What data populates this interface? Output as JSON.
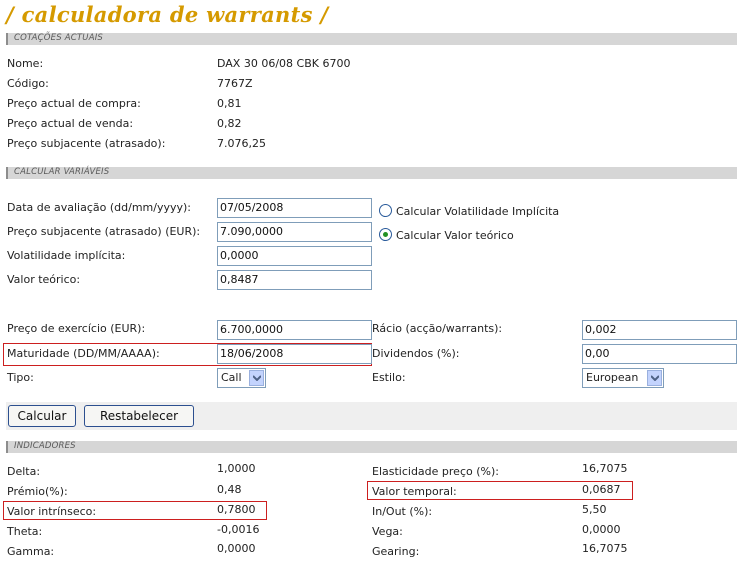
{
  "title": "/ calculadora de warrants /",
  "cotacoes": {
    "header": "COTAÇÕES ACTUAIS",
    "rows": [
      {
        "label": "Nome:",
        "value": "DAX 30 06/08 CBK 6700"
      },
      {
        "label": "Código:",
        "value": "7767Z"
      },
      {
        "label": "Preço actual de compra:",
        "value": "0,81"
      },
      {
        "label": "Preço actual de venda:",
        "value": "0,82"
      },
      {
        "label": "Preço subjacente (atrasado):",
        "value": "7.076,25"
      }
    ]
  },
  "calcular": {
    "header": "CALCULAR VARIÁVEIS",
    "data_avaliacao": {
      "label": "Data de avaliação (dd/mm/yyyy):",
      "value": "07/05/2008"
    },
    "preco_subjacente": {
      "label": "Preço subjacente (atrasado) (EUR):",
      "value": "7.090,0000"
    },
    "volatilidade": {
      "label": "Volatilidade implícita:",
      "value": "0,0000"
    },
    "valor_teorico": {
      "label": "Valor teórico:",
      "value": "0,8487"
    },
    "radio_volatilidade": "Calcular Volatilidade Implícita",
    "radio_valor": "Calcular Valor teórico",
    "preco_exercicio": {
      "label": "Preço de exercício (EUR):",
      "value": "6.700,0000"
    },
    "maturidade": {
      "label": "Maturidade (DD/MM/AAAA):",
      "value": "18/06/2008"
    },
    "tipo": {
      "label": "Tipo:",
      "value": "Call"
    },
    "racio": {
      "label": "Rácio (acção/warrants):",
      "value": "0,002"
    },
    "dividendos": {
      "label": "Dividendos (%):",
      "value": "0,00"
    },
    "estilo": {
      "label": "Estilo:",
      "value": "European"
    }
  },
  "buttons": {
    "calcular": "Calcular",
    "restabelecer": "Restabelecer"
  },
  "indicadores": {
    "header": "INDICADORES",
    "left": [
      {
        "label": "Delta:",
        "value": "1,0000"
      },
      {
        "label": "Prémio(%):",
        "value": "0,48"
      },
      {
        "label": "Valor intrínseco:",
        "value": "0,7800"
      },
      {
        "label": "Theta:",
        "value": "-0,0016"
      },
      {
        "label": "Gamma:",
        "value": "0,0000"
      }
    ],
    "right": [
      {
        "label": "Elasticidade preço (%):",
        "value": "16,7075"
      },
      {
        "label": "Valor temporal:",
        "value": "0,0687"
      },
      {
        "label": "In/Out (%):",
        "value": "5,50"
      },
      {
        "label": "Vega:",
        "value": "0,0000"
      },
      {
        "label": "Gearing:",
        "value": "16,7075"
      }
    ]
  },
  "colors": {
    "title": "#d59a00",
    "section_bar": "#d6d6d6",
    "highlight": "#cc1f1f",
    "radio_dot": "#239023"
  }
}
